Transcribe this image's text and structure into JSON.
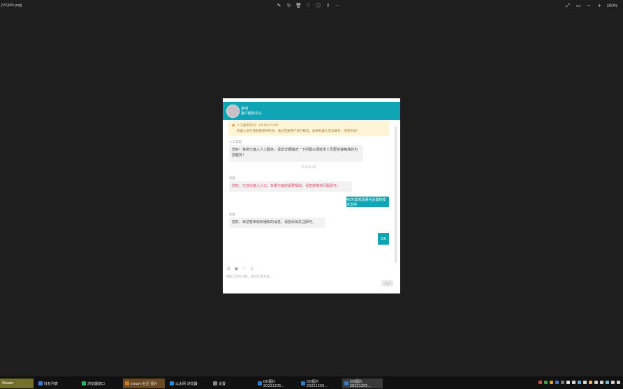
{
  "viewer": {
    "filename": "[\\\\\\\\\\]\\#\\\\\\.png]",
    "zoom": "100%",
    "toolbar_center_icons": [
      "edit-icon",
      "rotate-icon",
      "delete-icon",
      "favorite-icon",
      "info-icon",
      "share-icon",
      "more-icon"
    ],
    "toolbar_right_icons": [
      "fullscreen-icon",
      "fit-icon",
      "zoom-out-icon",
      "zoom-in-icon"
    ]
  },
  "chat": {
    "header": {
      "name": "咨询",
      "subtitle": "客户服务中心"
    },
    "notice": {
      "line1": "人工服务时间：09:00-21:00",
      "line2": "机器人会在非智能接待时间，通过回复用户进行解答，如果机器人无法解答，还请见谅!"
    },
    "messages": [
      {
        "sender": "人工客服",
        "text": "您好！系统已接入人工服务，请您详细描述一下问题以便技术人员更快速精准的为您服务！",
        "style": "normal"
      },
      {
        "divider": "今天11:00"
      },
      {
        "sender": "客服",
        "text": "您好，已成功接入人工，有哪方面的需要帮助，请直接描述问题即可。",
        "style": "red"
      },
      {
        "mine": "40无需修改语言设置和技术支持"
      },
      {
        "sender": "客服",
        "text": "您好，目前暂未收到通知的消息，请您添加关注即可。",
        "style": "normal"
      },
      {
        "mine": "OK"
      }
    ],
    "input_hint": "请输入您的问题，按回车键发送",
    "send_label": "发送"
  },
  "taskbar": {
    "start": "Steam",
    "items": [
      {
        "label": "好友列表",
        "color": "#3d7bd6"
      },
      {
        "label": "浏览器窗口",
        "color": "#2bb36b"
      },
      {
        "label": "steam 社区·图片",
        "color": "#c77a2a"
      },
      {
        "label": "以太网 浏览器",
        "color": "#2a8ad6"
      },
      {
        "label": "设置",
        "color": "#888888"
      },
      {
        "label": "OO图片20221205...",
        "color": "#2f7bc7"
      },
      {
        "label": "OO图片20221205...",
        "color": "#2f7bc7"
      },
      {
        "label": "OO图片20221205...",
        "color": "#2f7bc7"
      }
    ],
    "tray_colors": [
      "#e04848",
      "#3aa84a",
      "#d6a42a",
      "#3a7bd6",
      "#7a7a7a",
      "#e0e0e0",
      "#d6d6d6",
      "#5ab0e0",
      "#d6d6d6",
      "#e0b84a",
      "#cfcfcf",
      "#cfcfcf",
      "#7ab0e0",
      "#cfcfcf",
      "#cfcfcf"
    ]
  }
}
